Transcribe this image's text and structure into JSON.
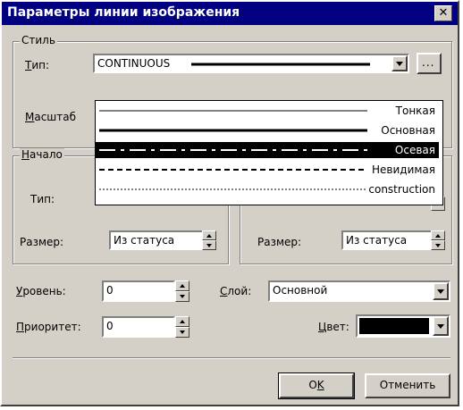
{
  "window": {
    "title": "Параметры линии изображения",
    "close_glyph": "✕"
  },
  "style_group": {
    "label": "Стиль",
    "type_label": "Тип:",
    "type_value": "CONTINUOUS",
    "browse_glyph": "...",
    "scale_label": "Масштаб"
  },
  "line_type_options": [
    {
      "label": "Тонкая",
      "line": "thin",
      "selected": false
    },
    {
      "label": "Основная",
      "line": "thick",
      "selected": false
    },
    {
      "label": "Осевая",
      "line": "dashdot",
      "selected": true
    },
    {
      "label": "Невидимая",
      "line": "dashed",
      "selected": false
    },
    {
      "label": "construction",
      "line": "dotted",
      "selected": false
    }
  ],
  "start_group": {
    "label": "Начало",
    "type_label": "Тип:",
    "size_label": "Размер:",
    "size_value": "Из статуса"
  },
  "end_group": {
    "size_label": "Размер:",
    "size_value": "Из статуса"
  },
  "level": {
    "label": "Уровень:",
    "value": "0"
  },
  "layer": {
    "label": "Слой:",
    "value": "Основной"
  },
  "priority": {
    "label": "Приоритет:",
    "value": "0"
  },
  "color": {
    "label": "Цвет:",
    "swatch": "#000000"
  },
  "buttons": {
    "ok": "OK",
    "cancel": "Отменить"
  }
}
